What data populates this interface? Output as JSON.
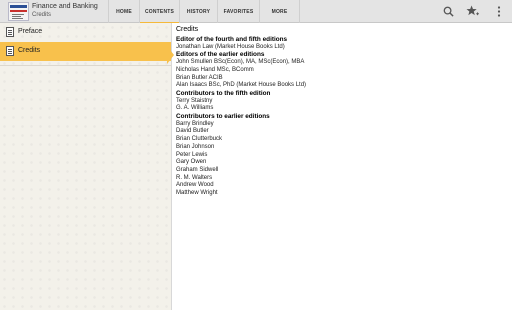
{
  "app": {
    "title": "Finance and Banking",
    "subtitle": "Credits",
    "icon_text": "Oxford Finance & Banking"
  },
  "tabs": [
    {
      "label": "HOME",
      "active": false
    },
    {
      "label": "CONTENTS",
      "active": true
    },
    {
      "label": "HISTORY",
      "active": false
    },
    {
      "label": "FAVORITES",
      "active": false
    },
    {
      "label": "MORE",
      "active": false
    }
  ],
  "actions": [
    "search-icon",
    "star-add-icon",
    "overflow-menu-icon"
  ],
  "sidebar": {
    "items": [
      {
        "label": "Preface",
        "selected": false,
        "icon": "document-icon"
      },
      {
        "label": "Credits",
        "selected": true,
        "icon": "document-icon"
      }
    ]
  },
  "content": {
    "title": "Credits",
    "lines": [
      {
        "text": "Editor of the fourth and fifth editions",
        "heading": true
      },
      {
        "text": "Jonathan Law (Market House Books Ltd)",
        "heading": false
      },
      {
        "text": "Editors of the earlier editions",
        "heading": true
      },
      {
        "text": "John Smullen BSc(Econ), MA, MSc(Econ), MBA",
        "heading": false
      },
      {
        "text": "Nicholas Hand MSc, BComm",
        "heading": false
      },
      {
        "text": "Brian Butler ACIB",
        "heading": false
      },
      {
        "text": "Alan Isaacs BSc, PhD (Market House Books Ltd)",
        "heading": false
      },
      {
        "text": "Contributors to the fifth edition",
        "heading": true
      },
      {
        "text": "Terry Staistny",
        "heading": false
      },
      {
        "text": "G. A. Williams",
        "heading": false
      },
      {
        "text": "Contributors to earlier editions",
        "heading": true
      },
      {
        "text": "Barry Brindley",
        "heading": false
      },
      {
        "text": "David Butler",
        "heading": false
      },
      {
        "text": "Brian Clutterbuck",
        "heading": false
      },
      {
        "text": "Brian Johnson",
        "heading": false
      },
      {
        "text": "Peter Lewis",
        "heading": false
      },
      {
        "text": "Gary Owen",
        "heading": false
      },
      {
        "text": "Graham Sidwell",
        "heading": false
      },
      {
        "text": "R. M. Walters",
        "heading": false
      },
      {
        "text": "Andrew Wood",
        "heading": false
      },
      {
        "text": "Matthew Wright",
        "heading": false
      }
    ]
  },
  "colors": {
    "accent": "#f8c14c",
    "tab_indicator": "#f5b93a",
    "actionbar": "#e4e4e4",
    "sidebar_bg": "#f3f1ea"
  }
}
